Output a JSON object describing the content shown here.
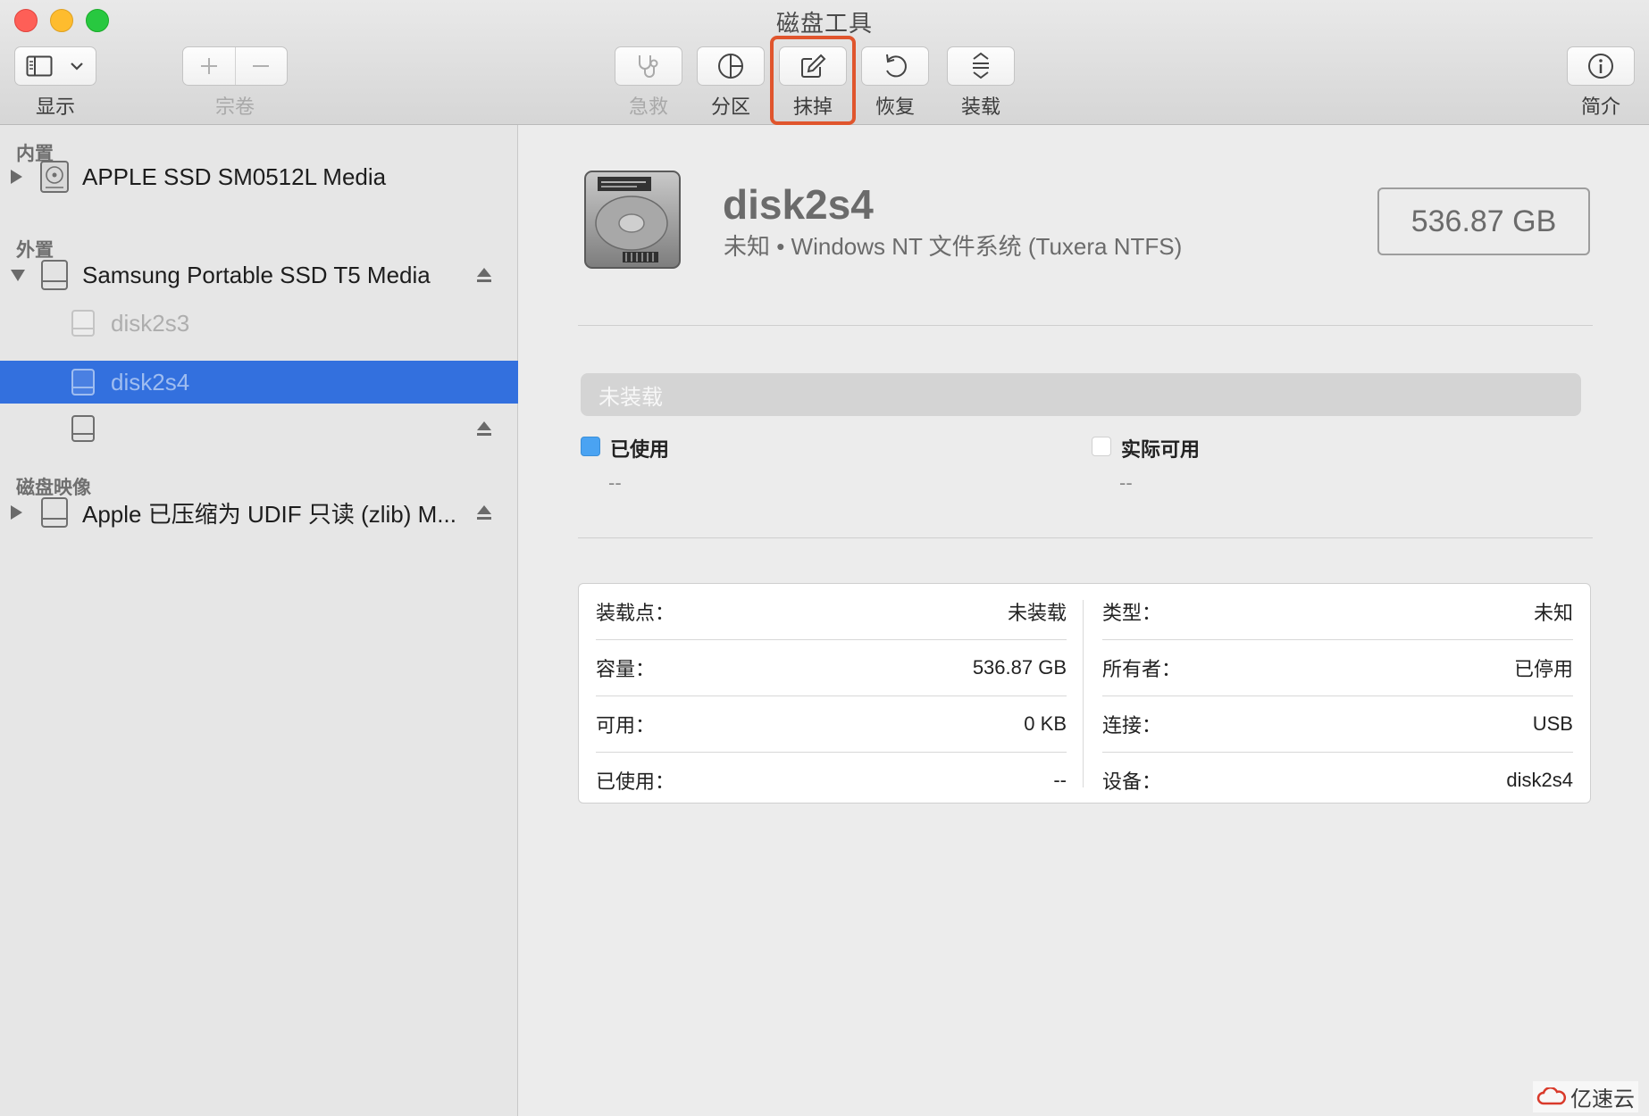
{
  "window": {
    "title": "磁盘工具"
  },
  "toolbar": {
    "view_label": "显示",
    "volume_label": "宗卷",
    "first_aid_label": "急救",
    "partition_label": "分区",
    "erase_label": "抹掉",
    "restore_label": "恢复",
    "mount_label": "装载",
    "info_label": "简介"
  },
  "sidebar": {
    "sections": {
      "internal": "内置",
      "external": "外置",
      "disk_images": "磁盘映像"
    },
    "items": {
      "apple_ssd": "APPLE SSD SM0512L Media",
      "samsung": "Samsung Portable SSD T5 Media",
      "disk2s3": "disk2s3",
      "disk2s4": "disk2s4",
      "unnamed": "",
      "apple_image": "Apple 已压缩为 UDIF 只读 (zlib) M..."
    }
  },
  "main": {
    "disk_name": "disk2s4",
    "disk_sub": "未知 • Windows NT 文件系统 (Tuxera NTFS)",
    "size": "536.87 GB",
    "usage_bar_label": "未装载",
    "legend": {
      "used_label": "已使用",
      "used_value": "--",
      "available_label": "实际可用",
      "available_value": "--"
    },
    "info": {
      "left": [
        {
          "key": "装载点：",
          "value": "未装载"
        },
        {
          "key": "容量：",
          "value": "536.87 GB"
        },
        {
          "key": "可用：",
          "value": "0 KB"
        },
        {
          "key": "已使用：",
          "value": "--"
        }
      ],
      "right": [
        {
          "key": "类型：",
          "value": "未知"
        },
        {
          "key": "所有者：",
          "value": "已停用"
        },
        {
          "key": "连接：",
          "value": "USB"
        },
        {
          "key": "设备：",
          "value": "disk2s4"
        }
      ]
    }
  },
  "colors": {
    "selection": "#3370de",
    "used_swatch": "#4aa3f2",
    "highlight": "#e0552d"
  },
  "watermark": "亿速云"
}
